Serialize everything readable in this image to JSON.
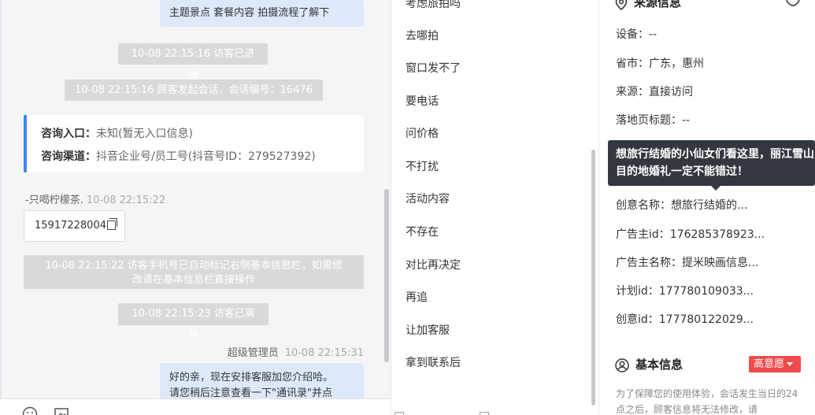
{
  "chat": {
    "top_bubble": "主题景点 套餐内容 拍摄流程了解下",
    "sys_enter": "10-08 22:15:16 访客已进线",
    "sys_session": "10-08 22:15:16 顾客发起会话，会话编号：16476",
    "entry_label": "咨询入口：",
    "entry_value": "未知(暂无入口信息)",
    "channel_label": "咨询渠道：",
    "channel_value": "抖音企业号/员工号(抖音号ID：279527392)",
    "visitor_name": "-只喝柠檬茶.",
    "visitor_time": "10-08 22:15:22",
    "visitor_phone": "15917228004",
    "sys_phone_line1": "10-08 22:15:22 访客手机号已自动标记右侧基本信息栏，如需修",
    "sys_phone_line2": "改请在基本信息栏直接操作",
    "sys_leave": "10-08 22:15:23 访客已离开",
    "agent_name": "超级管理员",
    "agent_time": "10-08 22:15:31",
    "agent_msg_line1": "好的亲，现在安排客服加您介绍哈。",
    "agent_msg_line2": "请您稍后注意查看一下\"通讯录\"并点"
  },
  "phrases": {
    "items": [
      "考虑旅拍吗",
      "去哪拍",
      "窗口发不了",
      "要电话",
      "问价格",
      "不打扰",
      "活动内容",
      "不存在",
      "对比再决定",
      "再追",
      "让加客服",
      "拿到联系后"
    ]
  },
  "info": {
    "source_title": "来源信息",
    "device": "设备：--",
    "province": "省市：广东，惠州",
    "source": "来源：直接访问",
    "landing_title": "落地页标题：--",
    "creative_name": "创意名称：想旅行结婚的...",
    "advertiser_id": "广告主id：176285378923...",
    "advertiser_name": "广告主名称：提米映画信息...",
    "plan_id": "计划id：177780109033...",
    "creative_id": "创意id：177780122029...",
    "basic_title": "基本信息",
    "intent": "高意愿",
    "notice": "为了保障您的使用体验，会话发生当日的24点之后，顾客信息将无法修改，请",
    "tooltip": "想旅行结婚的小仙女们看这里，丽江雪山目的地婚礼一定不能错过！"
  },
  "colors": {
    "accent": "#3d86f6",
    "bubble": "#dde9fb",
    "system_msg": "#d9d9d9",
    "intent_badge": "#f04b4b",
    "tooltip": "#333840"
  }
}
